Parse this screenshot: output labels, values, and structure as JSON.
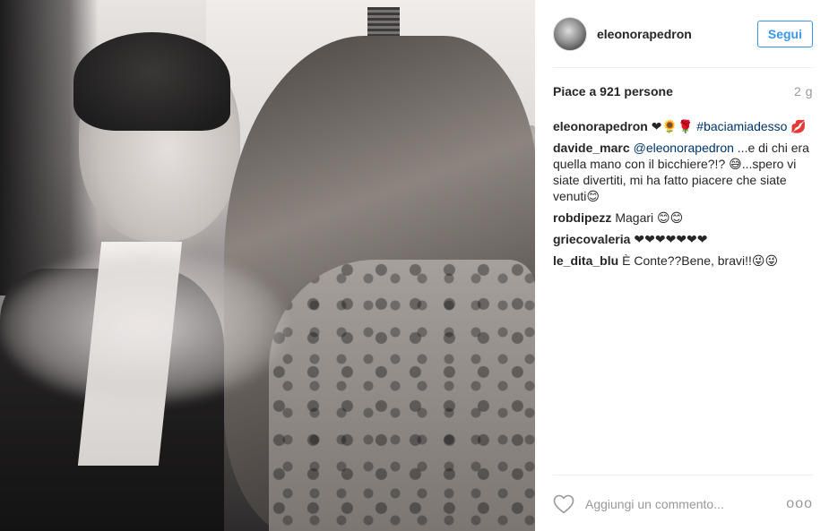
{
  "post": {
    "author": "eleonorapedron",
    "follow_label": "Segui",
    "likes_text": "Piace a 921 persone",
    "time_ago": "2 g"
  },
  "caption": {
    "author": "eleonorapedron",
    "text_emoji": "❤🌻🌹",
    "hashtag": "#baciamiadesso",
    "tail_emoji": "💋"
  },
  "comments": [
    {
      "author": "davide_marc",
      "mention": "@eleonorapedron",
      "text": " ...e di chi era quella mano con il bicchiere?!? 😅...spero vi siate divertiti, mi ha fatto piacere che siate venuti😊"
    },
    {
      "author": "robdipezz",
      "text": "Magari 😊😊"
    },
    {
      "author": "griecovaleria",
      "text": "❤❤❤❤❤❤❤"
    },
    {
      "author": "le_dita_blu",
      "text": "È Conte??Bene, bravi!!😜😜"
    }
  ],
  "footer": {
    "comment_placeholder": "Aggiungi un commento...",
    "more_label": "ooo"
  },
  "icons": {
    "heart": "heart-icon",
    "more": "more-options-icon"
  }
}
